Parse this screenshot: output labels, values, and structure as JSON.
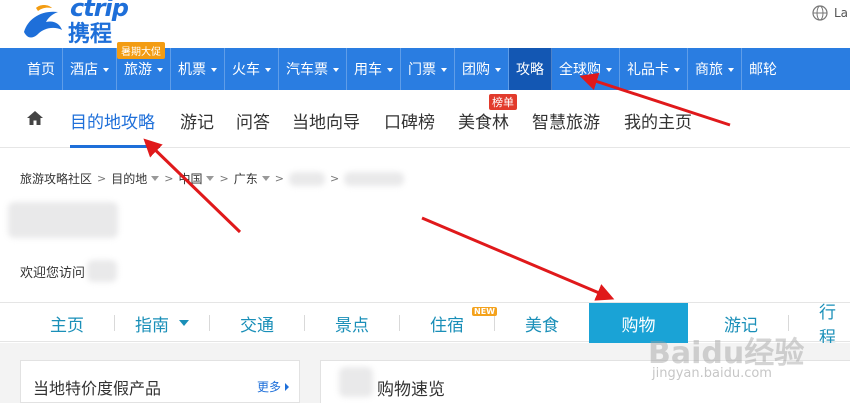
{
  "brand": {
    "logo_latin": "ctrip",
    "logo_cn": "携程",
    "language_label": "La"
  },
  "main_nav": {
    "items": [
      {
        "label": "首页",
        "caret": false
      },
      {
        "label": "酒店",
        "caret": true
      },
      {
        "label": "旅游",
        "caret": true,
        "badge": "暑期大促"
      },
      {
        "label": "机票",
        "caret": true
      },
      {
        "label": "火车",
        "caret": true
      },
      {
        "label": "汽车票",
        "caret": true
      },
      {
        "label": "用车",
        "caret": true
      },
      {
        "label": "门票",
        "caret": true
      },
      {
        "label": "团购",
        "caret": true
      },
      {
        "label": "攻略",
        "caret": false,
        "active": true
      },
      {
        "label": "全球购",
        "caret": true
      },
      {
        "label": "礼品卡",
        "caret": true
      },
      {
        "label": "商旅",
        "caret": true
      },
      {
        "label": "邮轮",
        "caret": false
      }
    ]
  },
  "sub_nav": {
    "items": [
      {
        "label": "目的地攻略",
        "active": true
      },
      {
        "label": "游记"
      },
      {
        "label": "问答"
      },
      {
        "label": "当地向导"
      },
      {
        "label": "口碑榜"
      },
      {
        "label": "美食林",
        "badge": "榜单"
      },
      {
        "label": "智慧旅游"
      },
      {
        "label": "我的主页"
      }
    ]
  },
  "breadcrumb": {
    "items": [
      "旅游攻略社区",
      "目的地",
      "中国",
      "广东"
    ]
  },
  "welcome_text": "欢迎您访问",
  "dest_tabs": {
    "items": [
      {
        "label": "主页"
      },
      {
        "label": "指南",
        "caret": true
      },
      {
        "label": "交通"
      },
      {
        "label": "景点"
      },
      {
        "label": "住宿",
        "badge": "NEW"
      },
      {
        "label": "美食"
      },
      {
        "label": "购物",
        "active": true
      },
      {
        "label": "游记"
      },
      {
        "label": "行程"
      }
    ]
  },
  "panels": {
    "left_title": "当地特价度假产品",
    "left_more": "更多",
    "right_title": "购物速览"
  },
  "watermark": {
    "main": "Baidu经验",
    "sub": "jingyan.baidu.com"
  },
  "colors": {
    "nav_blue": "#2a7de1",
    "nav_active": "#1357b3",
    "link_blue": "#1e6fd9",
    "tab_teal": "#1a8fb8",
    "tab_active": "#1aa3d6",
    "arrow_red": "#e0191b"
  }
}
